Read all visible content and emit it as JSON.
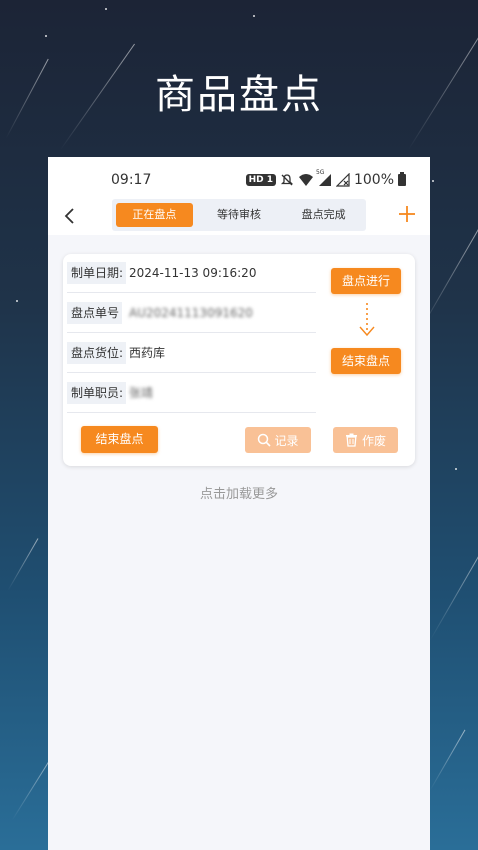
{
  "promo": {
    "title": "商品盘点"
  },
  "status_bar": {
    "time": "09:17",
    "hd_label": "HD 1",
    "signal_label": "5G",
    "battery": "100%",
    "icons": [
      "hd-badge",
      "mute-icon",
      "wifi-icon",
      "signal-icon",
      "no-signal-icon",
      "battery-icon"
    ]
  },
  "nav": {
    "back_icon": "chevron-left-icon",
    "tabs": [
      {
        "label": "正在盘点",
        "active": true
      },
      {
        "label": "等待审核",
        "active": false
      },
      {
        "label": "盘点完成",
        "active": false
      }
    ],
    "add_icon": "plus-icon",
    "accent": "#f6891f"
  },
  "card": {
    "rows": [
      {
        "label": "制单日期:",
        "value": "2024-11-13 09:16:20"
      },
      {
        "label": "盘点单号",
        "value": "AU20241113091620"
      },
      {
        "label": "盘点货位:",
        "value": "西药库"
      },
      {
        "label": "制单职员:",
        "value": "张靖"
      }
    ],
    "step_buttons": {
      "start": "盘点进行",
      "end": "结束盘点"
    },
    "actions": {
      "finish": "结束盘点",
      "record": "记录",
      "void": "作废"
    }
  },
  "load_more": "点击加载更多",
  "colors": {
    "orange": "#f6891f",
    "orange_pale": "#f9c196",
    "panel_bg": "#f5f6fa"
  }
}
